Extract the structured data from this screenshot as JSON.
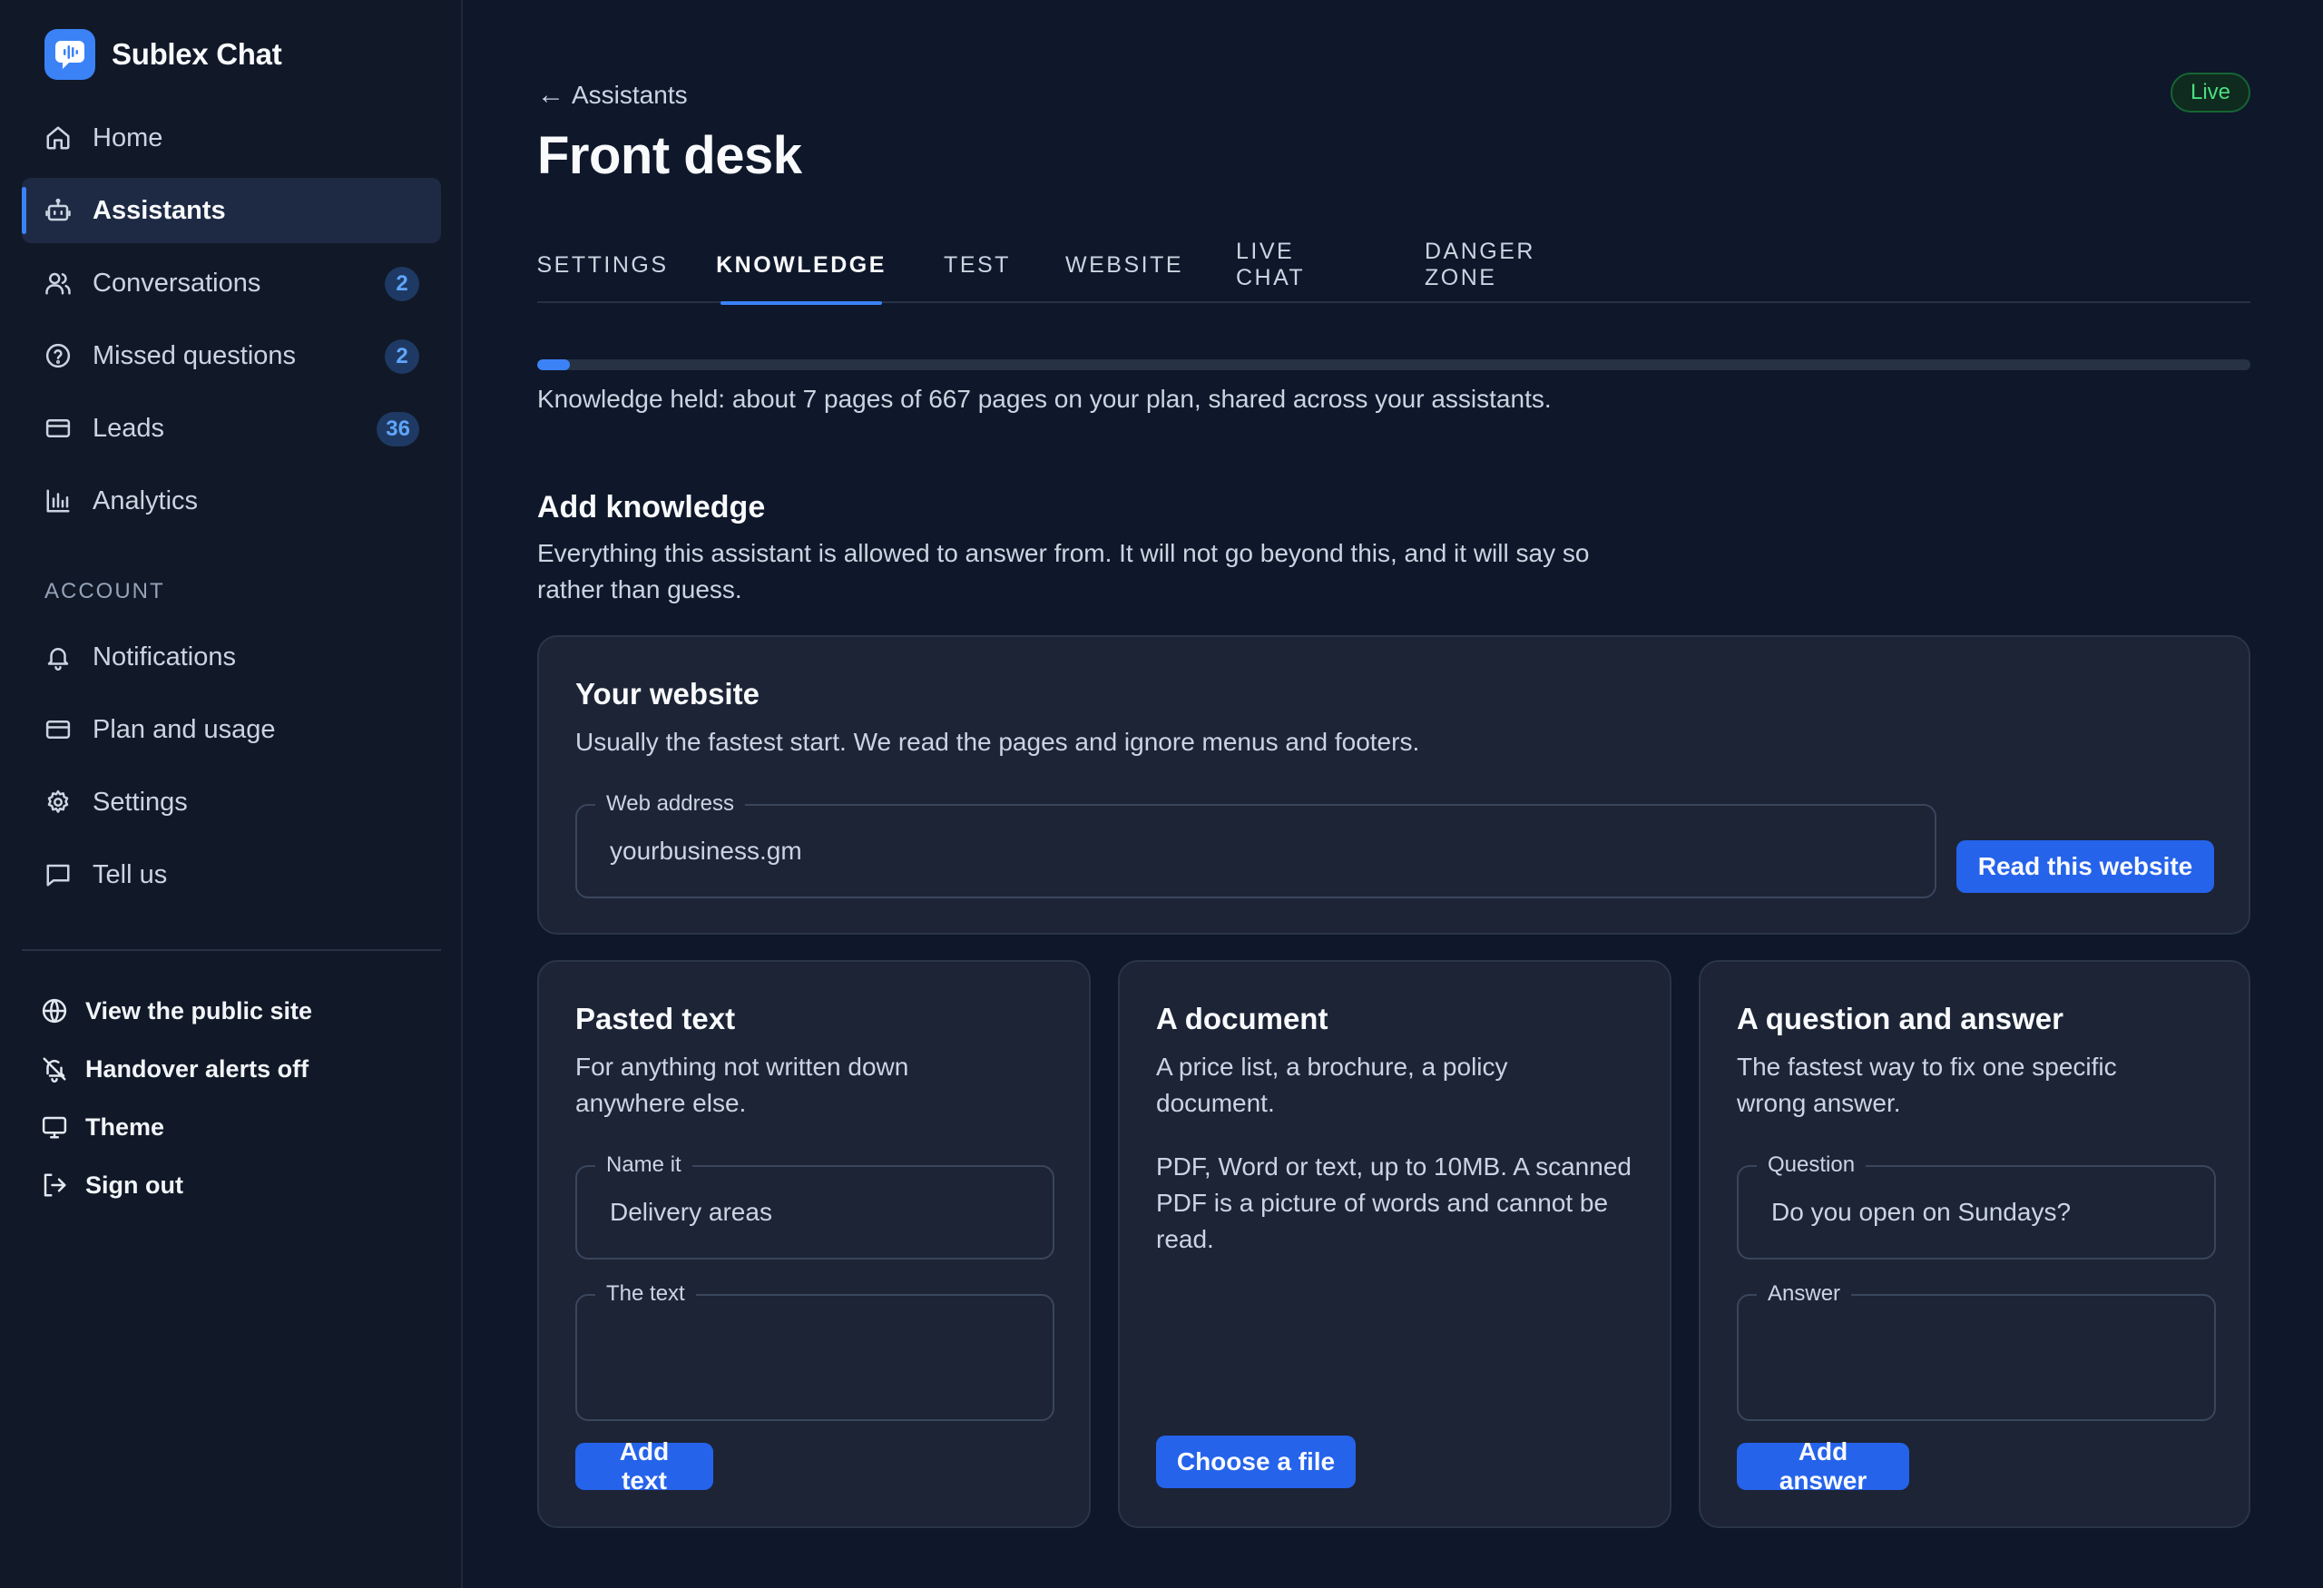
{
  "app": {
    "name": "Sublex Chat"
  },
  "sidebar": {
    "items": [
      {
        "label": "Home",
        "icon": "home-icon"
      },
      {
        "label": "Assistants",
        "icon": "bot-icon",
        "active": true
      },
      {
        "label": "Conversations",
        "icon": "users-icon",
        "badge": "2"
      },
      {
        "label": "Missed questions",
        "icon": "help-circle-icon",
        "badge": "2"
      },
      {
        "label": "Leads",
        "icon": "card-icon",
        "badge": "36"
      },
      {
        "label": "Analytics",
        "icon": "bar-chart-icon"
      }
    ],
    "account_label": "ACCOUNT",
    "account_items": [
      {
        "label": "Notifications",
        "icon": "bell-icon"
      },
      {
        "label": "Plan and usage",
        "icon": "card-icon"
      },
      {
        "label": "Settings",
        "icon": "gear-icon"
      },
      {
        "label": "Tell us",
        "icon": "message-icon"
      }
    ],
    "footer": [
      {
        "label": "View the public site",
        "icon": "globe-icon"
      },
      {
        "label": "Handover alerts off",
        "icon": "bell-off-icon"
      },
      {
        "label": "Theme",
        "icon": "monitor-icon"
      },
      {
        "label": "Sign out",
        "icon": "logout-icon"
      }
    ]
  },
  "header": {
    "back_label": "Assistants",
    "back_arrow": "←",
    "title": "Front desk",
    "status": "Live"
  },
  "tabs": [
    {
      "label": "SETTINGS"
    },
    {
      "label": "KNOWLEDGE",
      "active": true
    },
    {
      "label": "TEST"
    },
    {
      "label": "WEBSITE"
    },
    {
      "label": "LIVE CHAT"
    },
    {
      "label": "DANGER ZONE"
    }
  ],
  "usage": {
    "used_fraction": 0.0105,
    "text": "Knowledge held: about 7 pages of 667 pages on your plan, shared across your assistants."
  },
  "add_knowledge": {
    "title": "Add knowledge",
    "description": "Everything this assistant is allowed to answer from. It will not go beyond this, and it will say so rather than guess."
  },
  "website_card": {
    "title": "Your website",
    "description": "Usually the fastest start. We read the pages and ignore menus and footers.",
    "field_label": "Web address",
    "field_placeholder": "yourbusiness.gm",
    "button": "Read this website"
  },
  "text_card": {
    "title": "Pasted text",
    "description": "For anything not written down anywhere else.",
    "name_label": "Name it",
    "name_placeholder": "Delivery areas",
    "text_label": "The text",
    "button": "Add text"
  },
  "document_card": {
    "title": "A document",
    "description": "A price list, a brochure, a policy document.",
    "note": "PDF, Word or text, up to 10MB. A scanned PDF is a picture of words and cannot be read.",
    "button": "Choose a file"
  },
  "qa_card": {
    "title": "A question and answer",
    "description": "The fastest way to fix one specific wrong answer.",
    "question_label": "Question",
    "question_placeholder": "Do you open on Sundays?",
    "answer_label": "Answer",
    "button": "Add answer"
  }
}
